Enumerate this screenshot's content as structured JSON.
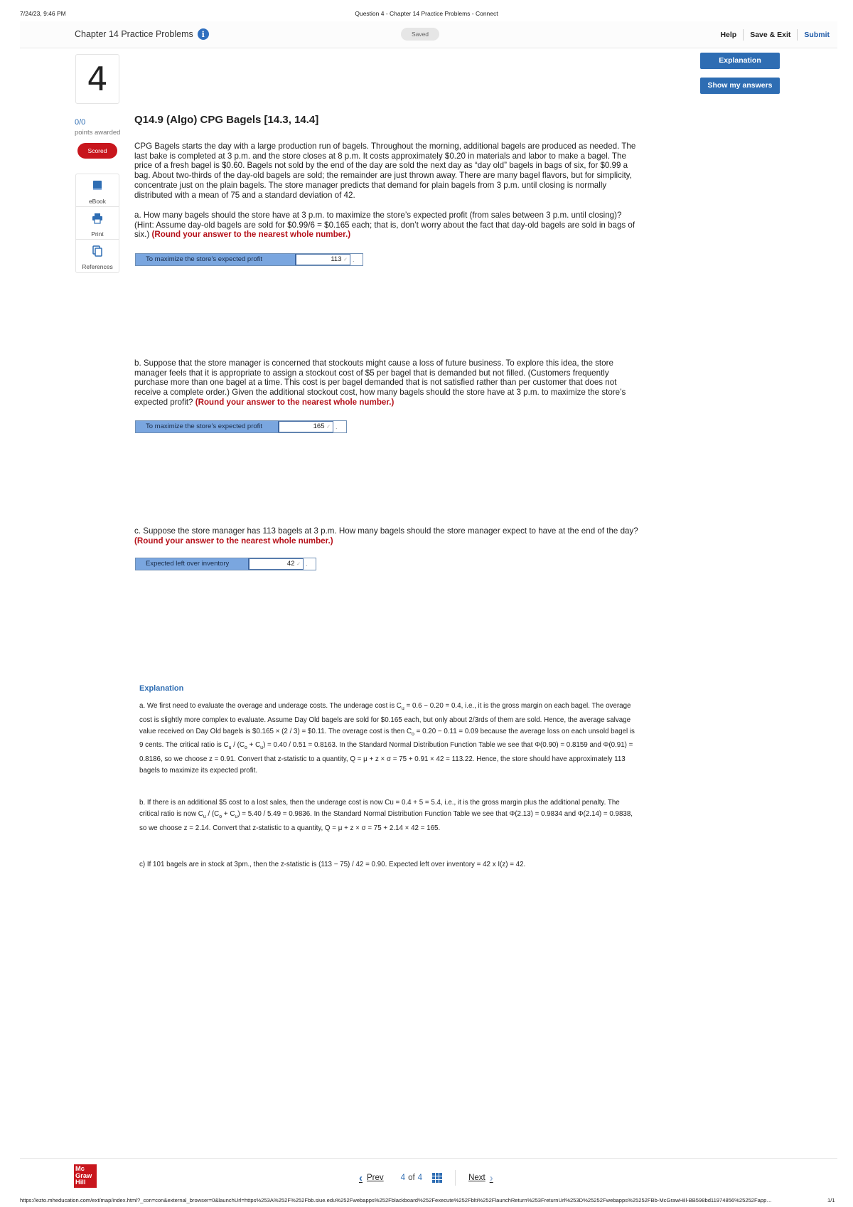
{
  "print_header": {
    "datetime": "7/24/23, 9:46 PM",
    "page_title": "Question 4 - Chapter 14 Practice Problems - Connect"
  },
  "header": {
    "assignment_title": "Chapter 14 Practice Problems",
    "info_icon": "i",
    "saved_label": "Saved",
    "help_label": "Help",
    "save_exit_label": "Save & Exit",
    "submit_label": "Submit"
  },
  "question_number": "4",
  "buttons": {
    "explanation": "Explanation",
    "show_answers": "Show my answers"
  },
  "score": {
    "points": "0/0",
    "points_label": "points awarded",
    "status": "Scored"
  },
  "tools": [
    {
      "label": "eBook",
      "icon": "book-icon"
    },
    {
      "label": "Print",
      "icon": "printer-icon"
    },
    {
      "label": "References",
      "icon": "references-icon"
    }
  ],
  "question": {
    "title": "Q14.9 (Algo) CPG Bagels [14.3, 14.4]",
    "intro": "CPG Bagels starts the day with a large production run of bagels. Throughout the morning, additional bagels are produced as needed. The last bake is completed at 3 p.m. and the store closes at 8 p.m. It costs approximately $0.20 in materials and labor to make a bagel. The price of a fresh bagel is $0.60. Bagels not sold by the end of the day are sold the next day as “day old” bagels in bags of six, for $0.99 a bag. About two-thirds of the day-old bagels are sold; the remainder are just thrown away. There are many bagel flavors, but for simplicity, concentrate just on the plain bagels. The store manager predicts that demand for plain bagels from 3 p.m. until closing is normally distributed with a mean of 75 and a standard deviation of 42.",
    "part_a": {
      "text": "a. How many bagels should the store have at 3 p.m. to maximize the store’s expected profit (from sales between 3 p.m. until closing)? (Hint: Assume day-old bagels are sold for $0.99/6 = $0.165 each; that is, don’t worry about the fact that day-old bagels are sold in bags of six.)",
      "instruction": "(Round your answer to the nearest whole number.)",
      "answer_label": "To maximize the store’s expected profit",
      "answer_value": "113"
    },
    "part_b": {
      "text": "b. Suppose that the store manager is concerned that stockouts might cause a loss of future business. To explore this idea, the store manager feels that it is appropriate to assign a stockout cost of $5 per bagel that is demanded but not filled. (Customers frequently purchase more than one bagel at a time. This cost is per bagel demanded that is not satisfied rather than per customer that does not receive a complete order.) Given the additional stockout cost, how many bagels should the store have at 3 p.m. to maximize the store’s expected profit?",
      "instruction": "(Round your answer to the nearest whole number.)",
      "answer_label": "To maximize the store’s expected profit",
      "answer_value": "165"
    },
    "part_c": {
      "text": "c. Suppose the store manager has 113 bagels at 3 p.m. How many bagels should the store manager expect to have at the end of the day?",
      "instruction": "(Round your answer to the nearest whole number.)",
      "answer_label": "Expected left over inventory",
      "answer_value": "42"
    }
  },
  "explanation": {
    "title": "Explanation",
    "a_1": "a. We first need to evaluate the overage and underage costs. The underage cost is C",
    "a_1_sub": "u",
    "a_2": " = 0.6 − 0.20 = 0.4, i.e., it is the gross margin on each bagel.  The overage cost is slightly more complex to evaluate.  Assume Day Old bagels are sold for $0.165 each, but only about 2/3rds of them are sold.  Hence, the average salvage value received on Day Old bagels is $0.165 × (2 / 3) = $0.11. The overage cost is then C",
    "a_2_sub": "o",
    "a_3": " = 0.20 − 0.11 = 0.09 because the average loss on each unsold bagel is 9 cents. The critical ratio is C",
    "a_3_sub": "u",
    "a_4": " / (C",
    "a_4_sub": "o",
    "a_5": " + C",
    "a_5_sub": "u",
    "a_6": ") = 0.40 / 0.51 = 0.8163. In the Standard Normal Distribution Function Table we see that Φ(0.90) = 0.8159 and Φ(0.91) = 0.8186,  so we choose z = 0.91. Convert that z-statistic to a quantity, Q = μ + z × σ = 75 + 0.91 × 42 = 113.22. Hence, the store should have approximately 113 bagels to maximize its expected profit.",
    "b_1": "b. If there is an additional $5 cost to a lost sales, then the underage cost is now Cu = 0.4 + 5 = 5.4, i.e., it is the gross margin plus the additional penalty.  The critical ratio is now C",
    "b_1_sub": "u",
    "b_2": " / (C",
    "b_2_sub": "o",
    "b_3": " + C",
    "b_3_sub": "u",
    "b_4": ") = 5.40 / 5.49 = 0.9836. In the Standard Normal Distribution Function Table we see that Φ(2.13) = 0.9834 and Φ(2.14) = 0.9838,  so we choose z = 2.14. Convert that z-statistic to a quantity, Q = μ + z × σ = 75 + 2.14 × 42 = 165.",
    "c": "c) If 101 bagels are in stock at 3pm., then the z-statistic is (113 − 75) / 42 = 0.90.  Expected left over inventory = 42 x I(z) =  42."
  },
  "footer": {
    "logo_line1": "Mc",
    "logo_line2": "Graw",
    "logo_line3": "Hill",
    "prev_label": "Prev",
    "current_page": "4",
    "of_label": "of",
    "total_pages": "4",
    "next_label": "Next"
  },
  "print_footer": {
    "url": "https://ezto.mheducation.com/ext/map/index.html?_con=con&external_browser=0&launchUrl=https%253A%252F%252Fbb.siue.edu%252Fwebapps%252Fblackboard%252Fexecute%252Fblti%252FlaunchReturn%253FreturnUrl%253D%25252Fwebapps%25252FBb-McGrawHill-BB598bd11974856%25252Fapp…",
    "page": "1/1"
  }
}
